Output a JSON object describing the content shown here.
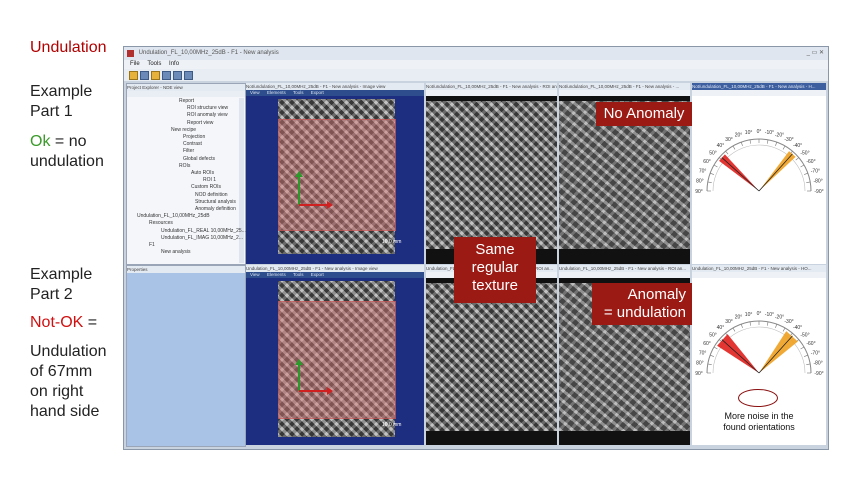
{
  "slide": {
    "title": "Undulation",
    "example1": {
      "heading_line1": "Example",
      "heading_line2": "Part 1",
      "ok_word": "Ok",
      "ok_rest": " = no",
      "ok_line2": "undulation"
    },
    "example2": {
      "heading_line1": "Example",
      "heading_line2": "Part 2",
      "notok_word": "Not-OK",
      "notok_rest": " =",
      "desc_line1": "Undulation",
      "desc_line2": "of 67mm",
      "desc_line3": "on right",
      "desc_line4": "hand side"
    }
  },
  "app": {
    "window_title": "Undulation_FL_10,00MHz_25dB - F1 - New analysis",
    "menu": [
      "File",
      "Tools",
      "Info"
    ],
    "explorer_title": "Project Explorer - NDE view",
    "properties_title": "Properties",
    "tree_items": [
      "Report",
      "ROI structure view",
      "ROI anomaly view",
      "Report view",
      "New recipe",
      "Projection",
      "Contrast",
      "Filter",
      "Global defects",
      "ROIs",
      "Auto ROIs",
      "ROI 1",
      "Custom ROIs",
      "NOD definition",
      "Structural analysis",
      "Anomaly definition",
      "Undulation_FL_10,00MHz_25dB",
      "Resources",
      "Undulation_FL_REAL 10,00MHz_25...",
      "Undulation_FL_IMAG 10,00MHz_2...",
      "F1",
      "New analysis"
    ],
    "top_panels": [
      "Not/undulation_FL_10,00MHz_25dB - F1 - New analysis - Image view",
      "Not/undulation_FL_10,00MHz_25dB - F1 - New analysis - ROI an...",
      "Not/undulation_FL_10,00MHz_25dB - F1 - New analysis - ...",
      "Not/undulation_FL_10,00MHz_25dB - F1 - New analysis - H..."
    ],
    "bottom_panels": [
      "Undulation_FL_10,00MHz_25dB - F1 - New analysis - Image view",
      "Undulation_FL_10,00MHz_25dB - F1 - New analysis - ROI an...",
      "Undulation_FL_10,00MHz_25dB - F1 - New analysis - ROI an...",
      "Undulation_FL_10,00MHz_25dB - F1 - New analysis - HO..."
    ],
    "image_toolbar": [
      "View",
      "Elements",
      "Tools",
      "Export"
    ],
    "scale_label": "10,0 mm"
  },
  "callouts": {
    "no_anomaly": "No Anomaly",
    "same_line1": "Same",
    "same_line2": "regular",
    "same_line3": "texture",
    "anomaly_line1": "Anomaly",
    "anomaly_line2": "= undulation",
    "noise_line1": "More noise in the",
    "noise_line2": "found orientations"
  },
  "protractor": {
    "tick_labels": [
      "90°",
      "80°",
      "70°",
      "60°",
      "50°",
      "40°",
      "30°",
      "20°",
      "10°",
      "0°",
      "-10°",
      "-20°",
      "-30°",
      "-40°",
      "-50°",
      "-60°",
      "-70°",
      "-80°",
      "-90°"
    ],
    "colors": {
      "red_wedge": "#e0201c",
      "orange_wedge": "#f0a020"
    }
  }
}
